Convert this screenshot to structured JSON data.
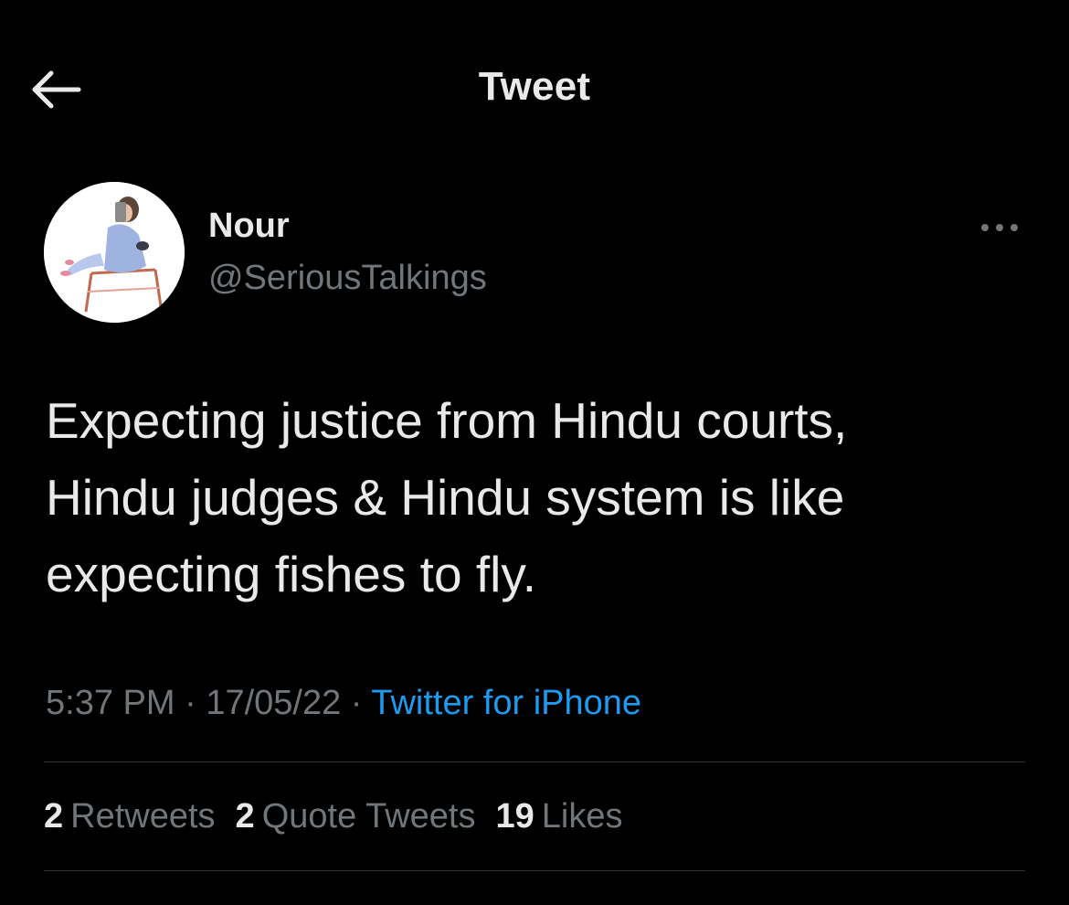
{
  "header": {
    "title": "Tweet",
    "back_icon": "arrow-left-icon"
  },
  "tweet": {
    "author": {
      "name": "Nour",
      "handle": "@SeriousTalkings",
      "avatar_icon": "avatar-illustration"
    },
    "more_icon": "more-horizontal-icon",
    "text": "Expecting justice from Hindu courts,\nHindu judges & Hindu system is like\nexpecting fishes to fly.",
    "time": "5:37 PM",
    "separator": "·",
    "date": "17/05/22",
    "source": "Twitter for iPhone",
    "stats": {
      "retweets_count": "2",
      "retweets_label": "Retweets",
      "quotes_count": "2",
      "quotes_label": "Quote Tweets",
      "likes_count": "19",
      "likes_label": "Likes"
    }
  },
  "colors": {
    "background": "#000000",
    "primary_text": "#e7e9ea",
    "secondary_text": "#71767b",
    "link": "#1d9bf0",
    "divider": "#2f3336"
  }
}
